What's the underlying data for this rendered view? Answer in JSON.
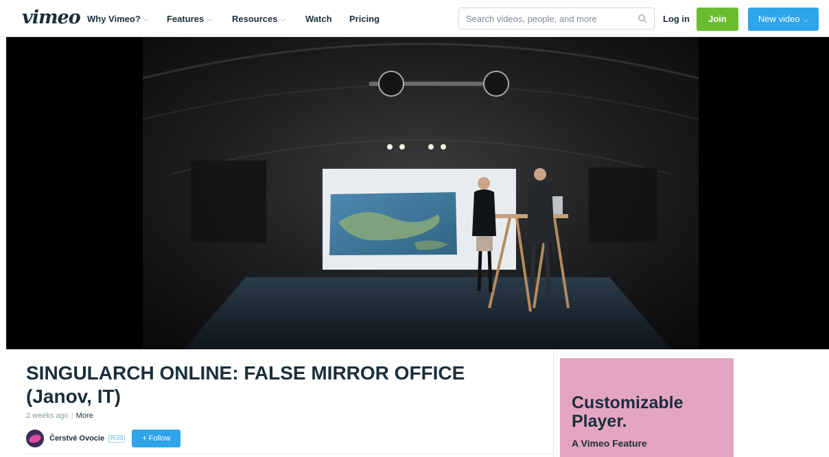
{
  "brand": {
    "logo_text": "vimeo"
  },
  "nav": {
    "items": [
      {
        "label": "Why Vimeo?",
        "has_dropdown": true
      },
      {
        "label": "Features",
        "has_dropdown": true
      },
      {
        "label": "Resources",
        "has_dropdown": true
      },
      {
        "label": "Watch",
        "has_dropdown": false
      },
      {
        "label": "Pricing",
        "has_dropdown": false
      }
    ],
    "search_placeholder": "Search videos, people, and more",
    "login_label": "Log in",
    "join_label": "Join",
    "new_video_label": "New video"
  },
  "video": {
    "title": "SINGULARCH ONLINE: FALSE MIRROR OFFICE (Janov, IT)",
    "posted": "2 weeks ago",
    "more_label": "More",
    "channel_name": "Čerstvé Ovocie",
    "channel_badge": "PLUS",
    "follow_label": "+ Follow"
  },
  "ad": {
    "title": "Customizable Player.",
    "subtitle": "A Vimeo Feature"
  },
  "colors": {
    "join_green": "#6bbd2f",
    "brand_blue": "#2ea4ea",
    "ad_pink": "#e4a5c2",
    "text_dark": "#1a2e3b"
  }
}
